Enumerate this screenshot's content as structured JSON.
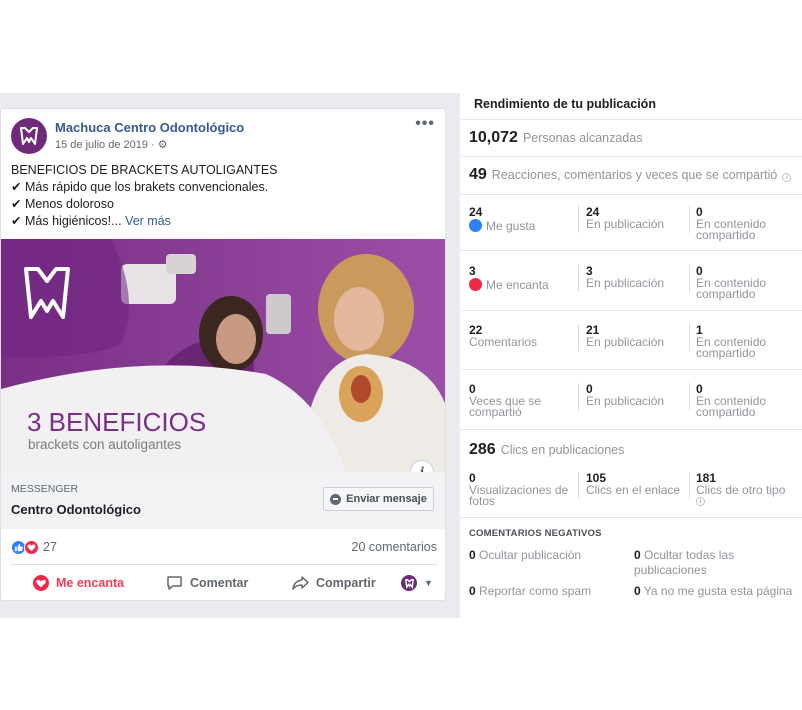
{
  "post": {
    "page_name": "Machuca Centro Odontológico",
    "date": "15 de julio de 2019 ·",
    "more_label": "•••",
    "text_heading": "BENEFICIOS DE BRACKETS AUTOLIGANTES",
    "bullets": [
      "Más rápido que los brakets convencionales.",
      "Menos doloroso",
      "Más higiénicos!..."
    ],
    "see_more": "Ver más",
    "banner": {
      "headline": "3 BENEFICIOS",
      "subline": "brackets con autoligantes"
    },
    "cta": {
      "label": "MESSENGER",
      "title": "Centro Odontológico",
      "button": "Enviar mensaje"
    },
    "reactions_count": "27",
    "comments_count": "20 comentarios",
    "actions": {
      "love": "Me encanta",
      "comment": "Comentar",
      "share": "Compartir"
    }
  },
  "stats": {
    "title": "Rendimiento de tu publicación",
    "reach": {
      "value": "10,072",
      "label": "Personas alcanzadas"
    },
    "engagement": {
      "value": "49",
      "label": "Reacciones, comentarios y veces que se compartió"
    },
    "rows": [
      {
        "total": "24",
        "total_label": "Me gusta",
        "on_post": "24",
        "on_post_label": "En publicación",
        "shared": "0",
        "shared_label": "En contenido compartido"
      },
      {
        "total": "3",
        "total_label": "Me encanta",
        "on_post": "3",
        "on_post_label": "En publicación",
        "shared": "0",
        "shared_label": "En contenido compartido"
      },
      {
        "total": "22",
        "total_label": "Comentarios",
        "on_post": "21",
        "on_post_label": "En publicación",
        "shared": "1",
        "shared_label": "En contenido compartido"
      },
      {
        "total": "0",
        "total_label": "Veces que se compartió",
        "on_post": "0",
        "on_post_label": "En publicación",
        "shared": "0",
        "shared_label": "En contenido compartido"
      }
    ],
    "clicks": {
      "value": "286",
      "label": "Clics en publicaciones"
    },
    "click_breakdown": [
      {
        "value": "0",
        "label": "Visualizaciones de fotos"
      },
      {
        "value": "105",
        "label": "Clics en el enlace"
      },
      {
        "value": "181",
        "label": "Clics de otro tipo"
      }
    ],
    "negative": {
      "title": "COMENTARIOS NEGATIVOS",
      "hide_post": {
        "value": "0",
        "label": "Ocultar publicación"
      },
      "hide_all": {
        "value": "0",
        "label": "Ocultar todas las publicaciones"
      },
      "spam": {
        "value": "0",
        "label": "Reportar como spam"
      },
      "unlike": {
        "value": "0",
        "label": "Ya no me gusta esta página"
      }
    }
  },
  "colors": {
    "brand_purple": "#6e2b77",
    "link_blue": "#385898",
    "like_blue": "#2e81f4",
    "love_red": "#f0284a"
  }
}
